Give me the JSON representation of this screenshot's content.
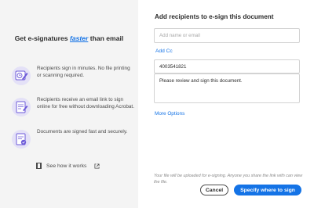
{
  "left": {
    "headline_before": "Get e-signatures ",
    "headline_accent": "faster",
    "headline_after": " than email",
    "features": [
      {
        "icon": "clock-pen-icon",
        "text": "Recipients sign in minutes. No file printing or scanning required."
      },
      {
        "icon": "document-link-icon",
        "text": "Recipients receive an email link to sign online for free without downloading Acrobat."
      },
      {
        "icon": "secure-document-icon",
        "text": "Documents are signed fast and securely."
      }
    ],
    "see_how": "See how it works"
  },
  "right": {
    "title": "Add recipients to e-sign this document",
    "email_placeholder": "Add name or email",
    "add_cc": "Add Cc",
    "phone_value": "4003541821",
    "message_value": "Please review and sign this document.",
    "more_options": "More Options",
    "disclaimer": "Your file will be uploaded for e-signing. Anyone you share the link with can view the file.",
    "cancel_label": "Cancel",
    "primary_label": "Specify where to sign"
  },
  "colors": {
    "accent": "#1473e6",
    "left_bg": "#f4f4f4",
    "icon_purple": "#6e5bd8"
  }
}
